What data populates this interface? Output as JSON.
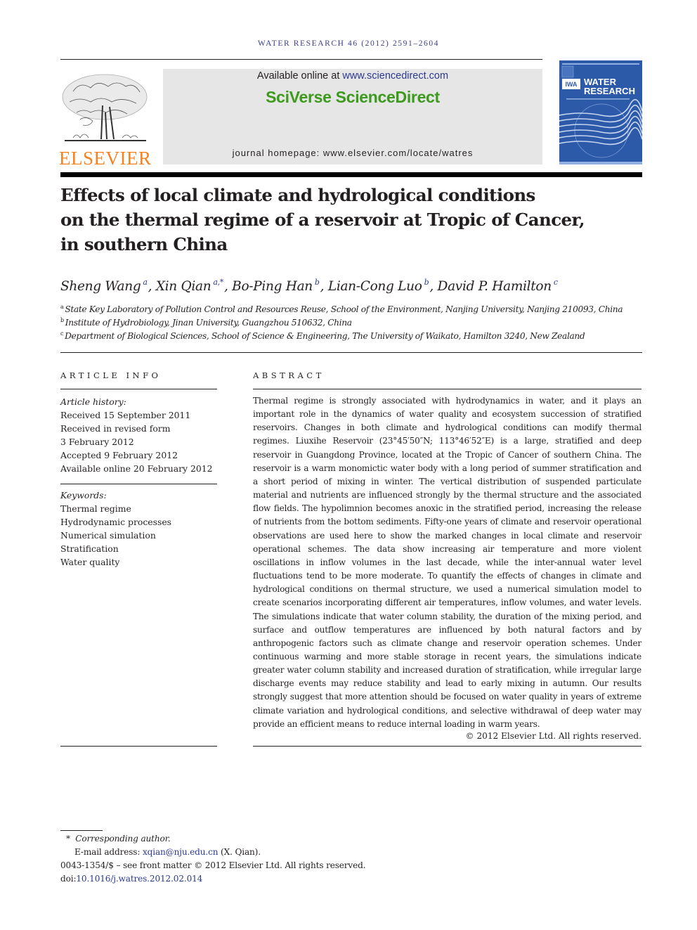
{
  "header": {
    "running_head": "WATER RESEARCH 46 (2012) 2591–2604",
    "publisher_logo_text": "ELSEVIER",
    "available_prefix": "Available online at ",
    "available_link": "www.sciencedirect.com",
    "platform_name": "SciVerse ScienceDirect",
    "journal_homepage_label": "journal homepage: ",
    "journal_homepage_url": "www.elsevier.com/locate/watres",
    "cover": {
      "association": "IWA",
      "journal_line1": "WATER",
      "journal_line2": "RESEARCH"
    }
  },
  "article": {
    "title_lines": [
      "Effects of local climate and hydrological conditions",
      "on the thermal regime of a reservoir at Tropic of Cancer,",
      "in southern China"
    ],
    "authors": [
      {
        "name": "Sheng Wang",
        "affil": "a",
        "sep": ", "
      },
      {
        "name": "Xin Qian",
        "affil": "a,*",
        "sep": ", "
      },
      {
        "name": "Bo-Ping Han",
        "affil": "b",
        "sep": ", "
      },
      {
        "name": "Lian-Cong Luo",
        "affil": "b",
        "sep": ", "
      },
      {
        "name": "David P. Hamilton",
        "affil": "c",
        "sep": ""
      }
    ],
    "affiliations": [
      {
        "key": "a",
        "text": "State Key Laboratory of Pollution Control and Resources Reuse, School of the Environment, Nanjing University, Nanjing 210093, China"
      },
      {
        "key": "b",
        "text": "Institute of Hydrobiology, Jinan University, Guangzhou 510632, China"
      },
      {
        "key": "c",
        "text": "Department of Biological Sciences, School of Science & Engineering, The University of Waikato, Hamilton 3240, New Zealand"
      }
    ]
  },
  "article_info": {
    "heading": "ARTICLE INFO",
    "history_label": "Article history:",
    "history": [
      "Received 15 September 2011",
      "Received in revised form",
      "3 February 2012",
      "Accepted 9 February 2012",
      "Available online 20 February 2012"
    ],
    "keywords_label": "Keywords:",
    "keywords": [
      "Thermal regime",
      "Hydrodynamic processes",
      "Numerical simulation",
      "Stratification",
      "Water quality"
    ]
  },
  "abstract": {
    "heading": "ABSTRACT",
    "text": "Thermal regime is strongly associated with hydrodynamics in water, and it plays an important role in the dynamics of water quality and ecosystem succession of stratified reservoirs. Changes in both climate and hydrological conditions can modify thermal regimes. Liuxihe Reservoir (23°45′50″N; 113°46′52″E) is a large, stratified and deep reservoir in Guangdong Province, located at the Tropic of Cancer of southern China. The reservoir is a warm monomictic water body with a long period of summer stratification and a short period of mixing in winter. The vertical distribution of suspended particulate material and nutrients are influenced strongly by the thermal structure and the associated flow fields. The hypolimnion becomes anoxic in the stratified period, increasing the release of nutrients from the bottom sediments. Fifty-one years of climate and reservoir operational observations are used here to show the marked changes in local climate and reservoir operational schemes. The data show increasing air temperature and more violent oscillations in inflow volumes in the last decade, while the inter-annual water level fluctuations tend to be more moderate. To quantify the effects of changes in climate and hydrological conditions on thermal structure, we used a numerical simulation model to create scenarios incorporating different air temperatures, inflow volumes, and water levels. The simulations indicate that water column stability, the duration of the mixing period, and surface and outflow temperatures are influenced by both natural factors and by anthropogenic factors such as climate change and reservoir operation schemes. Under continuous warming and more stable storage in recent years, the simulations indicate greater water column stability and increased duration of stratification, while irregular large discharge events may reduce stability and lead to early mixing in autumn. Our results strongly suggest that more attention should be focused on water quality in years of extreme climate variation and hydrological conditions, and selective withdrawal of deep water may provide an efficient means to reduce internal loading in warm years.",
    "copyright": "© 2012 Elsevier Ltd. All rights reserved."
  },
  "footnotes": {
    "corresponding_marker": "*",
    "corresponding_label": "Corresponding author.",
    "email_label": "E-mail address: ",
    "email": "xqian@nju.edu.cn",
    "email_owner": " (X. Qian).",
    "front_matter": "0043-1354/$ – see front matter © 2012 Elsevier Ltd. All rights reserved.",
    "doi_label": "doi:",
    "doi": "10.1016/j.watres.2012.02.014"
  },
  "colors": {
    "link_blue": "#2b3990",
    "sciverse_green": "#3d9a1d",
    "elsevier_orange": "#f58220",
    "cover_blue": "#2d5aa8",
    "banner_gray": "#e6e6e6"
  }
}
